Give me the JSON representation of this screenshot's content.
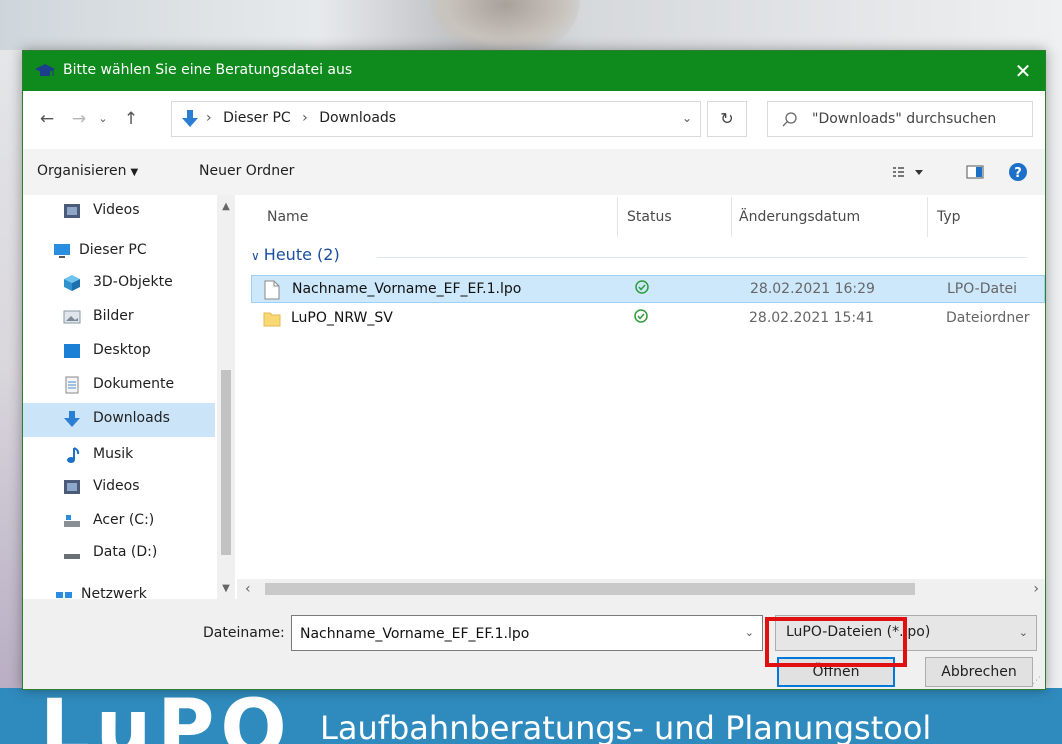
{
  "dialog": {
    "title": "Bitte wählen Sie eine Beratungsdatei aus",
    "close_glyph": "✕"
  },
  "address": {
    "crumbs": [
      "Dieser PC",
      "Downloads"
    ],
    "separator": "›",
    "search_placeholder": "\"Downloads\" durchsuchen"
  },
  "toolbar": {
    "organize_label": "Organisieren",
    "new_folder_label": "Neuer Ordner"
  },
  "sidebar": {
    "items": [
      {
        "label": "Videos",
        "icon": "video-icon"
      },
      {
        "label": "Dieser PC",
        "icon": "computer-icon"
      },
      {
        "label": "3D-Objekte",
        "icon": "3d-objects-icon"
      },
      {
        "label": "Bilder",
        "icon": "pictures-icon"
      },
      {
        "label": "Desktop",
        "icon": "desktop-icon"
      },
      {
        "label": "Dokumente",
        "icon": "documents-icon"
      },
      {
        "label": "Downloads",
        "icon": "download-icon",
        "selected": true
      },
      {
        "label": "Musik",
        "icon": "music-icon"
      },
      {
        "label": "Videos",
        "icon": "video-icon"
      },
      {
        "label": "Acer (C:)",
        "icon": "drive-icon"
      },
      {
        "label": "Data (D:)",
        "icon": "drive-icon"
      },
      {
        "label": "Netzwerk",
        "icon": "network-icon"
      }
    ]
  },
  "filelist": {
    "columns": [
      "Name",
      "Status",
      "Änderungsdatum",
      "Typ"
    ],
    "group_label": "Heute (2)",
    "rows": [
      {
        "name": "Nachname_Vorname_EF_EF.1.lpo",
        "date": "28.02.2021 16:29",
        "type": "LPO-Datei",
        "icon": "file-icon",
        "selected": true
      },
      {
        "name": "LuPO_NRW_SV",
        "date": "28.02.2021 15:41",
        "type": "Dateiordner",
        "icon": "folder-icon"
      }
    ]
  },
  "footer": {
    "filename_label": "Dateiname:",
    "filename_value": "Nachname_Vorname_EF_EF.1.lpo",
    "filter_value": "LuPO-Dateien (*.lpo)",
    "open_label": "Öffnen",
    "cancel_label": "Abbrechen"
  },
  "background": {
    "logo": "LuPO",
    "tagline": "Laufbahnberatungs- und Planungstool"
  },
  "colors": {
    "titlebar": "#0f8a1c",
    "selection": "#cce4f7",
    "highlight": "#e01010",
    "status_ok": "#2e9c3c",
    "group_text": "#1a4fa0",
    "app_bg": "#2f8bbd"
  }
}
